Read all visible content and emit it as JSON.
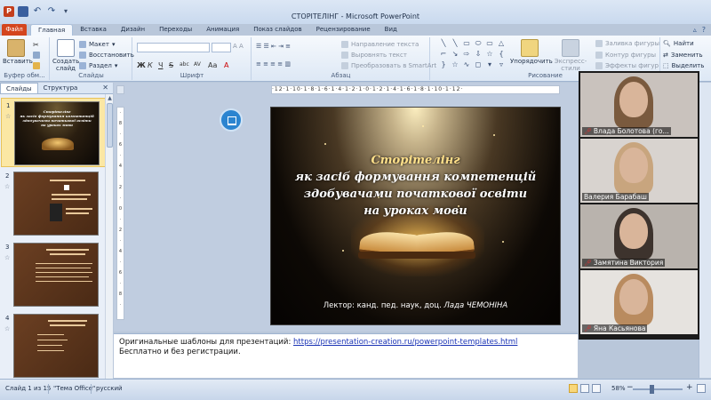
{
  "window": {
    "title": "СТОРІТЕЛІНГ - Microsoft PowerPoint"
  },
  "ribbon_tabs": {
    "file": "Файл",
    "items": [
      "Главная",
      "Вставка",
      "Дизайн",
      "Переходы",
      "Анимация",
      "Показ слайдов",
      "Рецензирование",
      "Вид"
    ]
  },
  "ribbon": {
    "clipboard": {
      "paste": "Вставить",
      "label": "Буфер обм..."
    },
    "slides": {
      "create_line1": "Создать",
      "create_line2": "слайд",
      "layout": "Макет",
      "reset": "Восстановить",
      "section": "Раздел",
      "label": "Слайды"
    },
    "font": {
      "label": "Шрифт",
      "bold": "Ж",
      "italic": "К",
      "underline": "Ч",
      "strike": "S",
      "shadow": "abc",
      "spacing": "AV",
      "case": "Aa",
      "color": "A"
    },
    "paragraph": {
      "label": "Абзац",
      "text_direction": "Направление текста",
      "align_text": "Выровнять текст",
      "smartart": "Преобразовать в SmartArt"
    },
    "drawing": {
      "label": "Рисование",
      "arrange": "Упорядочить",
      "quick_styles": "Экспресс-стили",
      "shape_fill": "Заливка фигуры",
      "shape_outline": "Контур фигуры",
      "shape_effects": "Эффекты фигур"
    },
    "editing": {
      "find": "Найти",
      "replace": "Заменить",
      "select": "Выделить"
    }
  },
  "panel": {
    "tab_slides": "Слайды",
    "tab_outline": "Структура"
  },
  "thumbnails": [
    {
      "num": "1"
    },
    {
      "num": "2"
    },
    {
      "num": "3"
    },
    {
      "num": "4"
    }
  ],
  "slide": {
    "title_line1": "Сторітелінг",
    "title_line2": "як засіб формування компетенцій",
    "title_line3": "здобувачами початкової освіти",
    "title_line4": "на уроках мови",
    "lecturer_prefix": "Лектор:  канд. пед. наук, доц.",
    "lecturer_name": "Лада ЧЕМОНІНА"
  },
  "notes": {
    "line1_text": "Оригинальные шаблоны для презентаций: ",
    "line1_link": "https://presentation-creation.ru/powerpoint-templates.html",
    "line2": "Бесплатно и без регистрации."
  },
  "participants": [
    {
      "name": "Влада Болотова (го...",
      "muted": true,
      "bg": "#c9c2bd",
      "hair": "#7a5a3e"
    },
    {
      "name": "Валерия Барабаш",
      "muted": false,
      "bg": "#d8d3cf",
      "hair": "#c8a57e"
    },
    {
      "name": "Замятина Виктория",
      "muted": true,
      "bg": "#b9b3ad",
      "hair": "#3d332d"
    },
    {
      "name": "Яна Касьянова",
      "muted": true,
      "bg": "#e6e3df",
      "hair": "#b98b5f"
    }
  ],
  "status": {
    "slide_indicator": "Слайд 1 из 15",
    "theme": "\"Тема Office\"",
    "language": "русский",
    "zoom": "58%",
    "zoom_minus": "−",
    "zoom_plus": "+"
  },
  "colors": {
    "file_tab": "#d4451d",
    "selected_thumb": "#fbe7a4",
    "slide_title": "#ffffff",
    "link": "#1a33b5"
  }
}
